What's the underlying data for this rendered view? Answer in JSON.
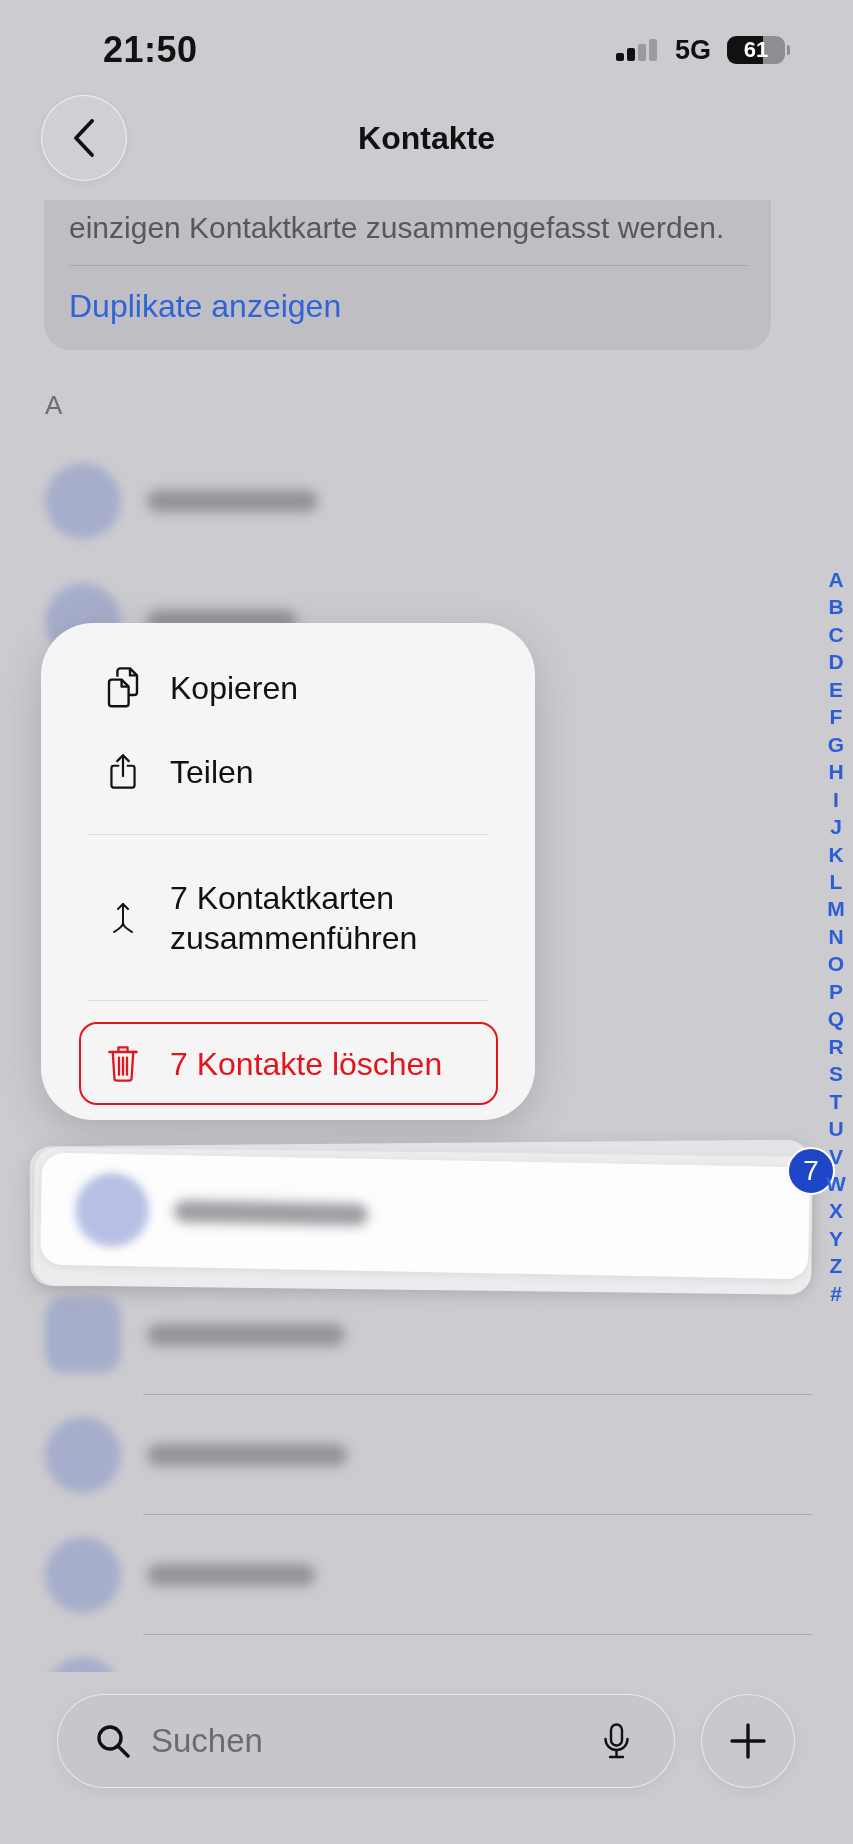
{
  "status_bar": {
    "time": "21:50",
    "network": "5G",
    "battery": "61"
  },
  "header": {
    "title": "Kontakte"
  },
  "info_card": {
    "text": "einzigen Kontaktkarte zusammengefasst werden.",
    "link": "Duplikate anzeigen"
  },
  "section": {
    "letter": "A"
  },
  "contacts_above": [
    {
      "kind": "person"
    },
    {
      "kind": "person"
    }
  ],
  "dragged_contacts": {
    "count": "7"
  },
  "contacts_below": [
    {
      "kind": "company"
    },
    {
      "kind": "person"
    },
    {
      "kind": "person"
    },
    {
      "kind": "person"
    }
  ],
  "context_menu": {
    "groups": [
      {
        "items": [
          {
            "kind": "copy",
            "label": "Kopieren",
            "highlighted": false
          },
          {
            "kind": "share",
            "label": "Teilen",
            "highlighted": false
          }
        ]
      },
      {
        "items": [
          {
            "kind": "merge",
            "label": "7 Kontaktkarten zusammenführen",
            "highlighted": false
          }
        ]
      },
      {
        "items": [
          {
            "kind": "delete",
            "label": "7 Kontakte löschen",
            "highlighted": true
          }
        ]
      }
    ]
  },
  "index": {
    "letters": [
      "A",
      "B",
      "C",
      "D",
      "E",
      "F",
      "G",
      "H",
      "I",
      "J",
      "K",
      "L",
      "M",
      "N",
      "O",
      "P",
      "Q",
      "R",
      "S",
      "T",
      "U",
      "V",
      "W",
      "X",
      "Y",
      "Z",
      "#"
    ]
  },
  "search": {
    "placeholder": "Suchen"
  }
}
